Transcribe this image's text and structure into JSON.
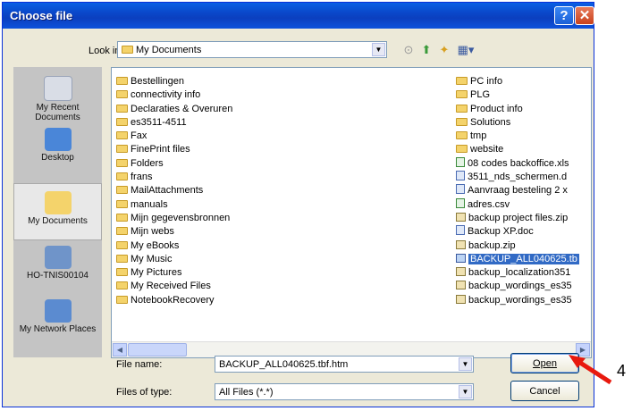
{
  "dialog": {
    "title": "Choose file"
  },
  "titlebar": {
    "help_glyph": "?",
    "close_glyph": "✕"
  },
  "lookin": {
    "label": "Look in:",
    "value": "My Documents",
    "arrow_icon": "▼"
  },
  "toolbar": {
    "icons": [
      "back-icon",
      "up-folder-icon",
      "new-folder-icon",
      "view-menu-icon"
    ]
  },
  "places": [
    {
      "label": "My Recent Documents",
      "icon": "recent-documents-icon",
      "color": "#d9dde6"
    },
    {
      "label": "Desktop",
      "icon": "desktop-icon",
      "color": "#4a86d8"
    },
    {
      "label": "My Documents",
      "icon": "my-documents-icon",
      "color": "#f4d36b"
    },
    {
      "label": "HO-TNIS00104",
      "icon": "my-computer-icon",
      "color": "#6f94c9"
    },
    {
      "label": "My Network Places",
      "icon": "network-places-icon",
      "color": "#5b8bd0"
    }
  ],
  "files": {
    "column1": [
      "Bestellingen",
      "connectivity info",
      "Declaraties & Overuren",
      "es3511-4511",
      "Fax",
      "FinePrint files",
      "Folders",
      "frans",
      "MailAttachments",
      "manuals",
      "Mijn gegevensbronnen",
      "Mijn webs",
      "My eBooks",
      "My Music",
      "My Pictures",
      "My Received Files",
      "NotebookRecovery"
    ],
    "column2": [
      "PC info",
      "PLG",
      "Product info",
      "Solutions",
      "tmp",
      "website",
      "08 codes backoffice.xls",
      "3511_nds_schermen.d",
      "Aanvraag besteling 2 x",
      "adres.csv",
      "backup project files.zip",
      "Backup XP.doc",
      "backup.zip",
      "BACKUP_ALL040625.tb",
      "backup_localization351",
      "backup_wordings_es35",
      "backup_wordings_es35"
    ]
  },
  "scrollbar": {
    "left_arrow": "◀",
    "right_arrow": "▶"
  },
  "filename": {
    "label": "File name:",
    "value": "BACKUP_ALL040625.tbf.htm"
  },
  "filetype": {
    "label": "Files of type:",
    "value": "All Files (*.*)"
  },
  "buttons": {
    "open": "Open",
    "cancel": "Cancel"
  },
  "annotation": {
    "label": "4"
  }
}
